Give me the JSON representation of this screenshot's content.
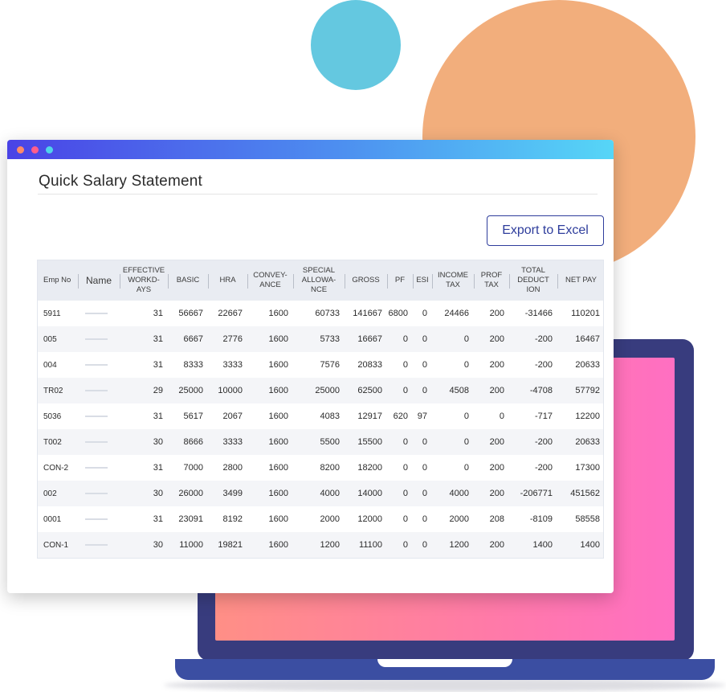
{
  "window": {
    "title": "Quick Salary Statement",
    "export_label": "Export to Excel"
  },
  "colors": {
    "titlebar_start": "#4a43e6",
    "titlebar_end": "#56d6f7",
    "accent": "#2e3d9c",
    "laptop_body": "#383c7e",
    "screen_pink": "#ff7aa8",
    "circle_orange": "#f2ae7c",
    "circle_blue": "#64c8e0"
  },
  "table": {
    "headers": [
      "Emp No",
      "Name",
      "EFFECTIVE WORKD-AYS",
      "BASIC",
      "HRA",
      "CONVEY-ANCE",
      "SPECIAL ALLOWA-NCE",
      "GROSS",
      "PF",
      "ESI",
      "INCOME TAX",
      "PROF TAX",
      "TOTAL DEDUCT ION",
      "NET PAY"
    ],
    "rows": [
      [
        "5911",
        "",
        "31",
        "56667",
        "22667",
        "1600",
        "60733",
        "141667",
        "6800",
        "0",
        "24466",
        "200",
        "-31466",
        "110201"
      ],
      [
        "005",
        "",
        "31",
        "6667",
        "2776",
        "1600",
        "5733",
        "16667",
        "0",
        "0",
        "0",
        "200",
        "-200",
        "16467"
      ],
      [
        "004",
        "",
        "31",
        "8333",
        "3333",
        "1600",
        "7576",
        "20833",
        "0",
        "0",
        "0",
        "200",
        "-200",
        "20633"
      ],
      [
        "TR02",
        "",
        "29",
        "25000",
        "10000",
        "1600",
        "25000",
        "62500",
        "0",
        "0",
        "4508",
        "200",
        "-4708",
        "57792"
      ],
      [
        "5036",
        "",
        "31",
        "5617",
        "2067",
        "1600",
        "4083",
        "12917",
        "620",
        "97",
        "0",
        "0",
        "-717",
        "12200"
      ],
      [
        "T002",
        "",
        "30",
        "8666",
        "3333",
        "1600",
        "5500",
        "15500",
        "0",
        "0",
        "0",
        "200",
        "-200",
        "20633"
      ],
      [
        "CON-2",
        "",
        "31",
        "7000",
        "2800",
        "1600",
        "8200",
        "18200",
        "0",
        "0",
        "0",
        "200",
        "-200",
        "17300"
      ],
      [
        "002",
        "",
        "30",
        "26000",
        "3499",
        "1600",
        "4000",
        "14000",
        "0",
        "0",
        "4000",
        "200",
        "-206771",
        "451562"
      ],
      [
        "0001",
        "",
        "31",
        "23091",
        "8192",
        "1600",
        "2000",
        "12000",
        "0",
        "0",
        "2000",
        "208",
        "-8109",
        "58558"
      ],
      [
        "CON-1",
        "",
        "30",
        "11000",
        "19821",
        "1600",
        "1200",
        "11100",
        "0",
        "0",
        "1200",
        "200",
        "1400",
        "1400"
      ]
    ]
  }
}
